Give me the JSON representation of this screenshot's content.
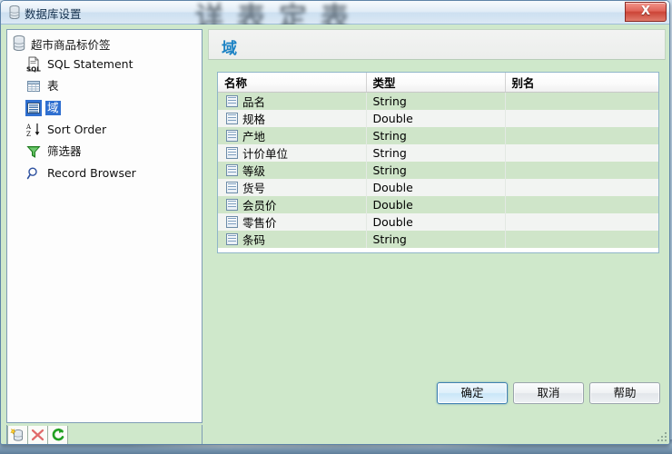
{
  "window": {
    "title": "数据库设置",
    "title_icon": "database-icon",
    "close_label": "X",
    "backdrop_text": "详表定表"
  },
  "sidebar": {
    "root": {
      "label": "超市商品标价签",
      "icon": "database-icon"
    },
    "items": [
      {
        "label": "SQL Statement",
        "icon": "sql-document-icon",
        "selected": false
      },
      {
        "label": "表",
        "icon": "table-grid-icon",
        "selected": false
      },
      {
        "label": "域",
        "icon": "field-list-icon",
        "selected": true
      },
      {
        "label": "Sort Order",
        "icon": "sort-az-icon",
        "selected": false
      },
      {
        "label": "筛选器",
        "icon": "funnel-filter-icon",
        "selected": false
      },
      {
        "label": "Record Browser",
        "icon": "magnifier-icon",
        "selected": false
      }
    ],
    "toolbar": [
      {
        "name": "new-database-button",
        "icon": "database-new-icon"
      },
      {
        "name": "delete-button",
        "icon": "red-x-icon"
      },
      {
        "name": "refresh-button",
        "icon": "green-refresh-icon"
      }
    ]
  },
  "panel": {
    "title": "域",
    "grid": {
      "columns": [
        "名称",
        "类型",
        "别名"
      ],
      "rows": [
        {
          "name": "品名",
          "type": "String",
          "alias": ""
        },
        {
          "name": "规格",
          "type": "Double",
          "alias": ""
        },
        {
          "name": "产地",
          "type": "String",
          "alias": ""
        },
        {
          "name": "计价单位",
          "type": "String",
          "alias": ""
        },
        {
          "name": "等级",
          "type": "String",
          "alias": ""
        },
        {
          "name": "货号",
          "type": "Double",
          "alias": ""
        },
        {
          "name": "会员价",
          "type": "Double",
          "alias": ""
        },
        {
          "name": "零售价",
          "type": "Double",
          "alias": ""
        },
        {
          "name": "条码",
          "type": "String",
          "alias": ""
        }
      ]
    }
  },
  "buttons": {
    "ok": "确定",
    "cancel": "取消",
    "help": "帮助"
  },
  "colors": {
    "panel_green": "#cfe8cb",
    "row_green": "#cfe5c9",
    "row_alt": "#f2f4f2",
    "title_blue": "#1b82c4",
    "selection_blue": "#2f6fd0"
  }
}
